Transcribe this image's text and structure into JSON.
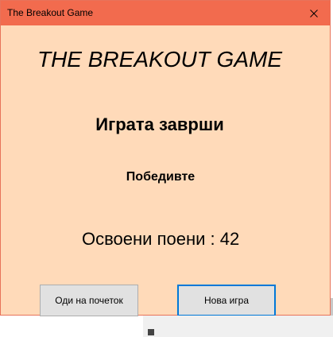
{
  "window": {
    "title": "The Breakout Game",
    "close_icon": "close-icon"
  },
  "content": {
    "game_title": "THE BREAKOUT GAME",
    "status": "Играта заврши",
    "result": "Победивте",
    "score_label": "Освоени поени : ",
    "score_value": "42"
  },
  "buttons": {
    "restart_label": "Оди на почеток",
    "new_game_label": "Нова игра"
  },
  "colors": {
    "titlebar": "#f26b4e",
    "window_background": "#ffdab9",
    "button_background": "#e1e1e1",
    "focus_border": "#0078d7"
  }
}
